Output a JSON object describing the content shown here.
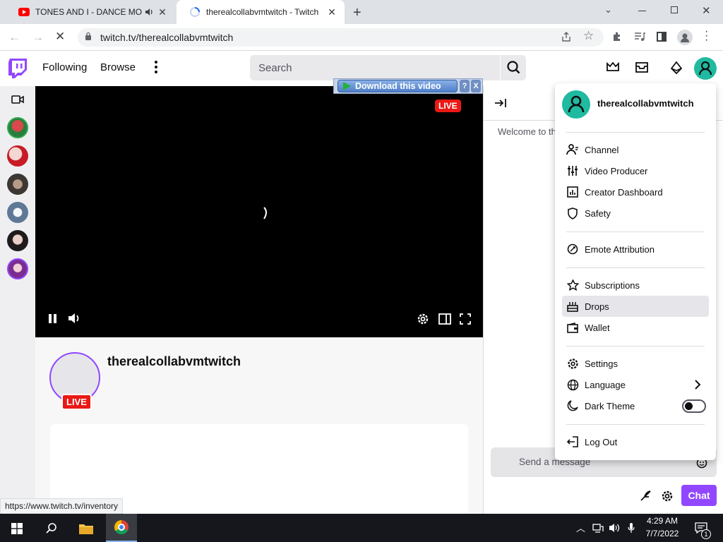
{
  "browser": {
    "tabs": [
      {
        "title": "TONES AND I - DANCE MONKEY",
        "favicon": "youtube-icon",
        "audio": true
      },
      {
        "title": "therealcollabvmtwitch - Twitch",
        "favicon": "loading-icon"
      }
    ],
    "url": "twitch.tv/therealcollabvmtwitch",
    "status_url": "https://www.twitch.tv/inventory"
  },
  "header": {
    "following": "Following",
    "browse": "Browse",
    "search_placeholder": "Search"
  },
  "player": {
    "live_badge": "LIVE",
    "download_label": "Download this video",
    "download_help": "?",
    "download_close": "X"
  },
  "channel": {
    "name": "therealcollabvmtwitch",
    "live_badge": "LIVE"
  },
  "chat": {
    "welcome": "Welcome to the chat room!",
    "input_placeholder": "Send a message",
    "chat_button": "Chat"
  },
  "user_menu": {
    "username": "therealcollabvmtwitch",
    "items": [
      {
        "label": "Channel",
        "icon": "person-icon"
      },
      {
        "label": "Video Producer",
        "icon": "sliders-icon"
      },
      {
        "label": "Creator Dashboard",
        "icon": "dashboard-icon"
      },
      {
        "label": "Safety",
        "icon": "shield-icon"
      },
      {
        "label": "Emote Attribution",
        "icon": "emote-icon"
      },
      {
        "label": "Subscriptions",
        "icon": "star-icon"
      },
      {
        "label": "Drops",
        "icon": "drops-icon"
      },
      {
        "label": "Wallet",
        "icon": "wallet-icon"
      },
      {
        "label": "Settings",
        "icon": "gear-icon"
      },
      {
        "label": "Language",
        "icon": "globe-icon"
      },
      {
        "label": "Dark Theme",
        "icon": "moon-icon",
        "toggle": false
      },
      {
        "label": "Log Out",
        "icon": "logout-icon"
      }
    ]
  },
  "taskbar": {
    "time": "4:29 AM",
    "date": "7/7/2022",
    "notifications": "1"
  },
  "colors": {
    "twitch_purple": "#9147ff",
    "live_red": "#e91916",
    "avatar_teal": "#1fba9f"
  }
}
